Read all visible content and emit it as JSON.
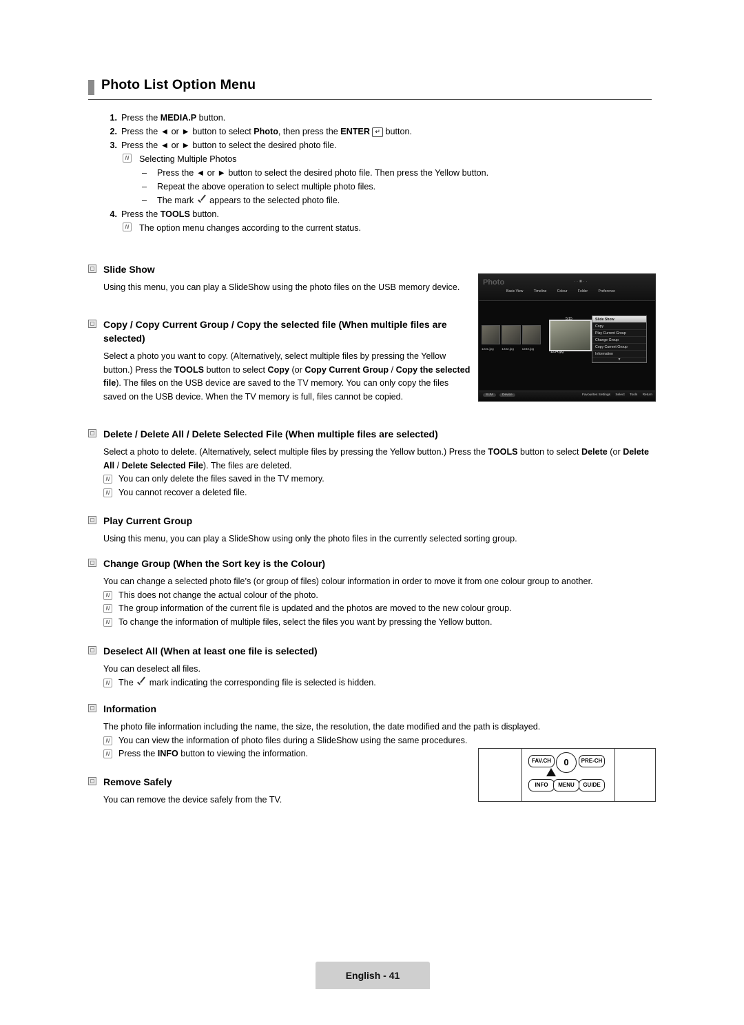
{
  "page": {
    "title": "Photo List Option Menu",
    "footer_label": "English - 41"
  },
  "steps": [
    {
      "num": "1.",
      "text_html": "Press the <b>MEDIA.P</b> button."
    },
    {
      "num": "2.",
      "text_html": "Press the &#9668; or &#9658; button to select <b>Photo</b>, then press the <b>ENTER</b> <span class=\"enter-icon\">&#8629;</span> button."
    },
    {
      "num": "3.",
      "text_html": "Press the &#9668; or &#9658; button to select the desired photo file."
    }
  ],
  "step3_note": "Selecting Multiple Photos",
  "step3_dashes": [
    "Press the &#9668; or &#9658; button to select the desired photo file. Then press the Yellow button.",
    "Repeat the above operation to select multiple photo files.",
    "The mark <span class=\"check\"></span> appears to the selected photo file."
  ],
  "step4": {
    "num": "4.",
    "text_html": "Press the <b>TOOLS</b> button."
  },
  "step4_note": "The option menu changes according to the current status.",
  "sections": [
    {
      "id": "slide-show",
      "heading": "Slide Show",
      "body_html": "Using this menu, you can play a SlideShow using the photo files on the USB memory device."
    },
    {
      "id": "copy",
      "heading": "Copy / Copy Current Group / Copy the selected file (When multiple files are selected)",
      "body_html": "Select a photo you want to copy. (Alternatively, select multiple files by pressing the Yellow button.) Press the <b>TOOLS</b> button to select <b>Copy</b> (or <b>Copy Current Group</b> / <b>Copy the selected file</b>). The files on the USB device are saved to the TV memory. You can only copy the files saved on the USB device. When the TV memory is full, files cannot be copied."
    },
    {
      "id": "delete",
      "heading": "Delete / Delete All / Delete Selected File (When multiple files are selected)",
      "body_html": "Select a photo to delete. (Alternatively, select multiple files by pressing the Yellow button.) Press the <b>TOOLS</b> button to select <b>Delete</b> (or <b>Delete All</b> / <b>Delete Selected File</b>). The files are deleted.",
      "notes": [
        "You can only delete the files saved in the TV memory.",
        "You cannot recover a deleted file."
      ]
    },
    {
      "id": "play-current-group",
      "heading": "Play Current Group",
      "body_html": "Using this menu, you can play a SlideShow using only the photo files in the currently selected sorting group."
    },
    {
      "id": "change-group",
      "heading": "Change Group (When the Sort key is the Colour)",
      "body_html": "You can change a selected photo file&#8217;s (or group of files) colour information in order to move it from one colour group to another.",
      "notes": [
        "This does not change the actual colour of the photo.",
        "The group information of the current file is updated and the photos are moved to the new colour group.",
        "To change the information of multiple files, select the files you want by pressing the Yellow button."
      ]
    },
    {
      "id": "deselect-all",
      "heading": "Deselect All (When at least one file is selected)",
      "body_html": "You can deselect all files.",
      "notes_html": [
        "The <span class=\"check\"></span> mark indicating the corresponding file is selected is hidden."
      ]
    },
    {
      "id": "information",
      "heading": "Information",
      "body_html": "The photo file information including the name, the size, the resolution, the date modified and the path is displayed.",
      "notes_html": [
        "You can view the information of photo files during a SlideShow using the same procedures.",
        "Press the <b>INFO</b> button to viewing the information."
      ]
    },
    {
      "id": "remove-safely",
      "heading": "Remove Safely",
      "body_html": "You can remove the device safely from the TV."
    }
  ],
  "tv_screenshot": {
    "app_label": "Photo",
    "tabs": [
      "Basic View",
      "Timeline",
      "Colour",
      "Folder",
      "Preference"
    ],
    "counter": "5/15",
    "thumb_labels": [
      "1231.jpg",
      "1232.jpg",
      "1233.jpg"
    ],
    "big_photo_label": "1234.jpg",
    "menu_items": [
      "Slide Show",
      "Copy",
      "Play Current Group",
      "Change Group",
      "Copy Current Group",
      "Information"
    ],
    "selected_menu_item": "Slide Show",
    "status_left": [
      "SUM",
      "Device"
    ],
    "status_right": [
      "Favourites Settings",
      "Select",
      "Tools",
      "Return"
    ]
  },
  "remote": {
    "buttons": [
      "FAV.CH",
      "PRE-CH",
      "INFO",
      "MENU",
      "GUIDE"
    ],
    "power_label": "0"
  }
}
